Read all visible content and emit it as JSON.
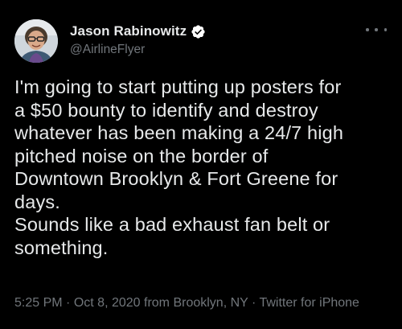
{
  "tweet": {
    "author": {
      "display_name": "Jason Rabinowitz",
      "handle": "@AirlineFlyer",
      "verified": true,
      "verified_icon": "verified-badge-icon",
      "avatar_icon": "user-avatar-photo"
    },
    "more_icon": "more-options-icon",
    "text_lines": [
      "I'm going to start putting up posters for",
      "a $50 bounty to identify and destroy",
      "whatever has been making a 24/7 high",
      "pitched noise on the border of",
      "Downtown Brooklyn & Fort Greene for",
      "days.",
      "Sounds like a bad exhaust fan belt or",
      "something."
    ],
    "meta": {
      "time": "5:25 PM",
      "separator": "·",
      "date_location": "Oct 8, 2020 from Brooklyn, NY",
      "source": "Twitter for iPhone"
    }
  },
  "colors": {
    "background": "#000000",
    "primary_text": "#e7e9ea",
    "secondary_text": "#71767b",
    "verified_badge": "#ffffff"
  }
}
